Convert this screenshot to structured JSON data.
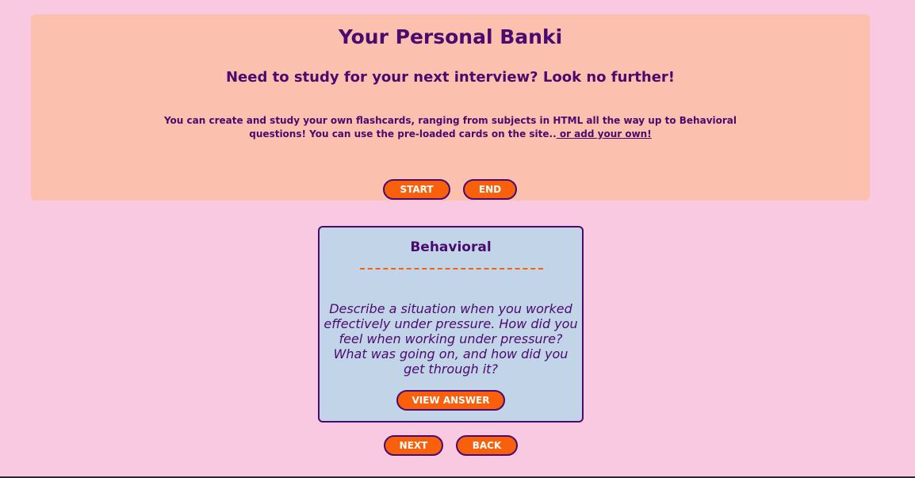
{
  "header": {
    "title": "Your Personal Banki",
    "tagline": "Need to study for your next interview? Look no further!",
    "intro_text": "You can create and study your own flashcards, ranging from subjects in HTML all the way up to Behavioral questions! You can use the pre-loaded cards on the site..",
    "intro_link": " or add your own!",
    "start_label": "START",
    "end_label": "END"
  },
  "card": {
    "category": "Behavioral",
    "question": "Describe a situation when you worked effectively under pressure. How did you feel when working under pressure? What was going on, and how did you get through it?",
    "view_answer_label": "VIEW ANSWER"
  },
  "navigation": {
    "next_label": "NEXT",
    "back_label": "BACK"
  },
  "colors": {
    "page_background": "#f8c9e0",
    "header_background": "#fbc1ae",
    "card_background": "#c2d4e8",
    "accent_orange": "#f9600b",
    "text_purple": "#4b0a6e"
  }
}
